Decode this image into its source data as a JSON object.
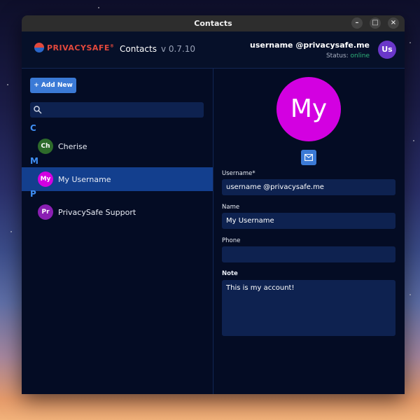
{
  "window": {
    "title": "Contacts",
    "controls": {
      "minimize": "–",
      "maximize": "□",
      "close": "×"
    }
  },
  "header": {
    "logo_text": "PRIVACYSAFE",
    "logo_mark": "®",
    "app_name": "Contacts",
    "version": "v 0.7.10",
    "user": {
      "name": "username @privacysafe.me",
      "status_label": "Status:",
      "status_value": "online",
      "initials": "Us"
    }
  },
  "sidebar": {
    "add_button": "+ Add New",
    "search_placeholder": "",
    "groups": [
      {
        "letter": "C",
        "contacts": [
          {
            "initials": "Ch",
            "name": "Cherise",
            "color": "#2e6b2b",
            "selected": false
          }
        ]
      },
      {
        "letter": "M",
        "contacts": [
          {
            "initials": "My",
            "name": "My Username",
            "color": "#d300e1",
            "selected": true
          }
        ]
      },
      {
        "letter": "P",
        "contacts": [
          {
            "initials": "Pr",
            "name": "PrivacySafe Support",
            "color": "#8a1fb3",
            "selected": false
          }
        ]
      }
    ]
  },
  "detail": {
    "avatar_initials": "My",
    "avatar_color": "#d300e1",
    "fields": {
      "username_label": "Username*",
      "username_value": "username @privacysafe.me",
      "name_label": "Name",
      "name_value": "My Username",
      "phone_label": "Phone",
      "phone_value": "",
      "note_label": "Note",
      "note_value": "This is my account!"
    }
  },
  "colors": {
    "accent": "#3b7ad6",
    "online": "#2fb57a",
    "selected_row": "#133f8e",
    "group_letter": "#3f8ef3"
  }
}
